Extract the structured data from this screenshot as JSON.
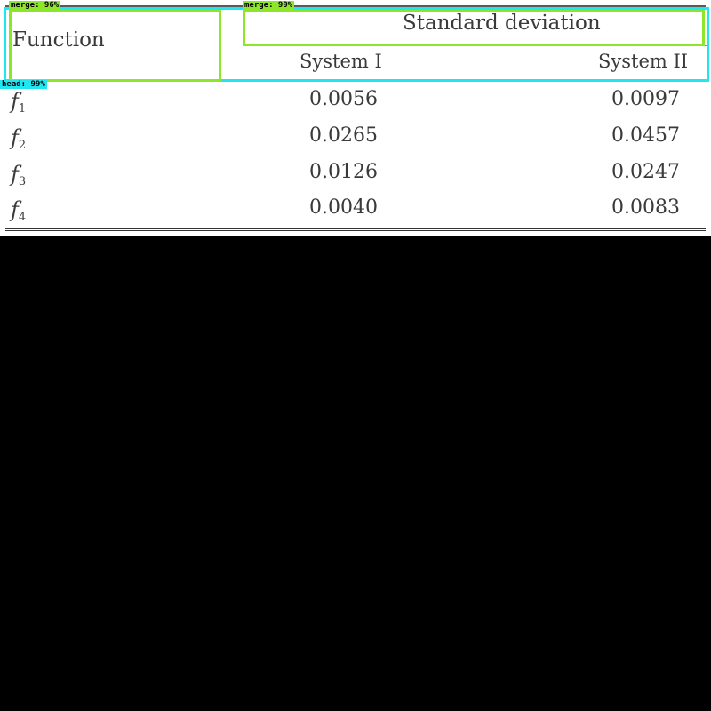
{
  "table": {
    "header": {
      "function": "Function",
      "group": "Standard deviation",
      "sub_columns": [
        "System I",
        "System II"
      ]
    },
    "rows": [
      {
        "fn": "f",
        "sub": "1",
        "system1": "0.0056",
        "system2": "0.0097"
      },
      {
        "fn": "f",
        "sub": "2",
        "system1": "0.0265",
        "system2": "0.0457"
      },
      {
        "fn": "f",
        "sub": "3",
        "system1": "0.0126",
        "system2": "0.0247"
      },
      {
        "fn": "f",
        "sub": "4",
        "system1": "0.0040",
        "system2": "0.0083"
      }
    ]
  },
  "overlays": {
    "labels": [
      "merge: 96%",
      "merge: 99%",
      "head: 99%"
    ],
    "colors": {
      "merge": "#8ee62a",
      "head": "#1fe6f0"
    }
  }
}
